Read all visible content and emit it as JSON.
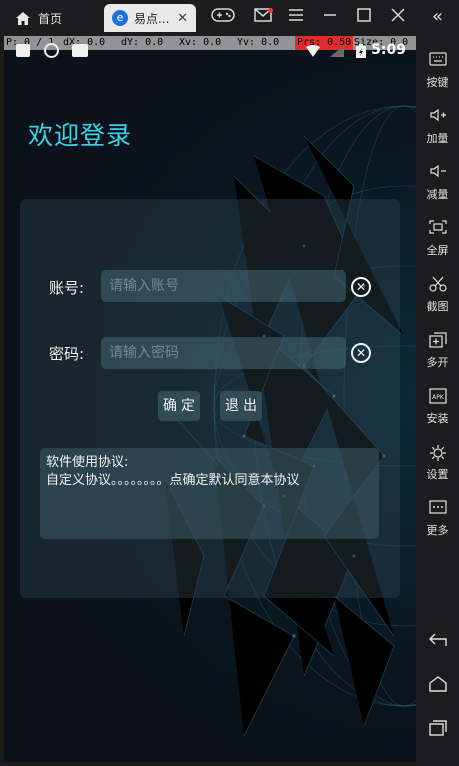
{
  "topbar": {
    "home_tab": "首页",
    "app_tab": "易点...",
    "app_icon_letter": "e",
    "close": "✕",
    "icons": [
      "gamepad-icon",
      "mail-icon",
      "menu-icon",
      "minimize-icon",
      "maximize-icon",
      "close-icon"
    ]
  },
  "debug": {
    "p": "P: 0 / 1",
    "dx": "dX: 0.0",
    "dy": "dY: 0.0",
    "xv": "Xv: 0.0",
    "yv": "Yv: 0.0",
    "prs": "Prs: 0.50",
    "size": "Size: 0.0"
  },
  "status": {
    "time": "5:09"
  },
  "login": {
    "title": "欢迎登录",
    "account_label": "账号:",
    "account_placeholder": "请输入账号",
    "password_label": "密码:",
    "password_placeholder": "请输入密码",
    "confirm_label": "确定",
    "exit_label": "退出",
    "agreement_title": "软件使用协议:",
    "agreement_text": "自定义协议。。。。。。。。点确定默认同意本协议"
  },
  "sidebar": {
    "collapse": "«",
    "items": [
      {
        "label": "按键",
        "icon": "keyboard-icon"
      },
      {
        "label": "加量",
        "icon": "volume-up-icon"
      },
      {
        "label": "减量",
        "icon": "volume-down-icon"
      },
      {
        "label": "全屏",
        "icon": "fullscreen-icon"
      },
      {
        "label": "截图",
        "icon": "scissors-icon"
      },
      {
        "label": "多开",
        "icon": "multi-open-icon"
      },
      {
        "label": "安装",
        "icon": "apk-icon"
      },
      {
        "label": "设置",
        "icon": "gear-icon"
      },
      {
        "label": "更多",
        "icon": "more-icon"
      }
    ],
    "nav": [
      "back-icon",
      "home-icon",
      "recents-icon"
    ]
  },
  "colors": {
    "accent": "#39d3e8",
    "background": "#0a141c",
    "chrome": "#1c1c1e"
  }
}
